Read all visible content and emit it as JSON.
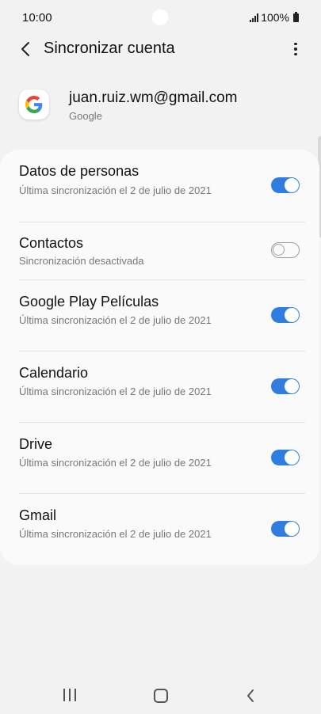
{
  "status_bar": {
    "time": "10:00",
    "battery": "100%"
  },
  "header": {
    "title": "Sincronizar cuenta"
  },
  "account": {
    "email": "juan.ruiz.wm@gmail.com",
    "type": "Google"
  },
  "sync_items": [
    {
      "title": "Datos de personas",
      "subtitle": "Última sincronización el 2 de julio de 2021",
      "enabled": true
    },
    {
      "title": "Contactos",
      "subtitle": "Sincronización desactivada",
      "enabled": false
    },
    {
      "title": "Google Play Películas",
      "subtitle": "Última sincronización el 2 de julio de 2021",
      "enabled": true
    },
    {
      "title": "Calendario",
      "subtitle": "Última sincronización el 2 de julio de 2021",
      "enabled": true
    },
    {
      "title": "Drive",
      "subtitle": "Última sincronización el 2 de julio de 2021",
      "enabled": true
    },
    {
      "title": "Gmail",
      "subtitle": "Última sincronización el 2 de julio de 2021",
      "enabled": true
    }
  ],
  "colors": {
    "accent": "#2f7ddf",
    "background": "#f2f2f2",
    "card": "#fafafa"
  }
}
